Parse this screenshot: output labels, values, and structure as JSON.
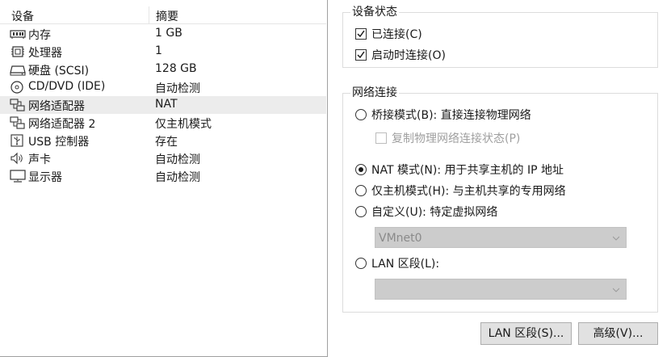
{
  "device_list": {
    "header_device": "设备",
    "header_summary": "摘要",
    "rows": [
      {
        "icon": "memory-icon",
        "name": "内存",
        "summary": "1 GB"
      },
      {
        "icon": "processor-icon",
        "name": "处理器",
        "summary": "1"
      },
      {
        "icon": "hard-disk-icon",
        "name": "硬盘 (SCSI)",
        "summary": "128 GB"
      },
      {
        "icon": "cd-dvd-icon",
        "name": "CD/DVD (IDE)",
        "summary": "自动检测"
      },
      {
        "icon": "network-adapter-icon",
        "name": "网络适配器",
        "summary": "NAT"
      },
      {
        "icon": "network-adapter-icon",
        "name": "网络适配器 2",
        "summary": "仅主机模式"
      },
      {
        "icon": "usb-icon",
        "name": "USB 控制器",
        "summary": "存在"
      },
      {
        "icon": "speaker-icon",
        "name": "声卡",
        "summary": "自动检测"
      },
      {
        "icon": "monitor-icon",
        "name": "显示器",
        "summary": "自动检测"
      }
    ],
    "selected_index": 4
  },
  "device_status": {
    "title": "设备状态",
    "connected_label": "已连接(C)",
    "connected_checked": true,
    "connect_at_power_on_label": "启动时连接(O)",
    "connect_at_power_on_checked": true
  },
  "network_connection": {
    "title": "网络连接",
    "bridged_label": "桥接模式(B): 直接连接物理网络",
    "replicate_label": "复制物理网络连接状态(P)",
    "nat_label": "NAT 模式(N): 用于共享主机的 IP 地址",
    "host_only_label": "仅主机模式(H): 与主机共享的专用网络",
    "custom_label": "自定义(U): 特定虚拟网络",
    "custom_network_value": "VMnet0",
    "lan_segment_label": "LAN 区段(L):",
    "lan_segment_value": "",
    "selected": "nat"
  },
  "buttons": {
    "lan_segments": "LAN 区段(S)...",
    "advanced": "高级(V)..."
  }
}
